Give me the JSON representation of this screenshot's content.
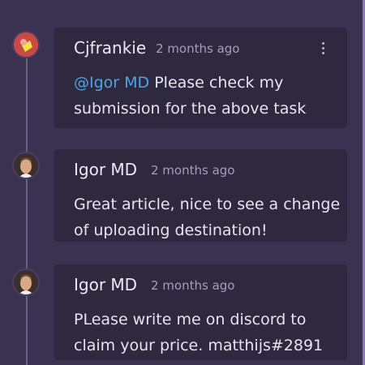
{
  "comments": [
    {
      "author": "Cjfrankie",
      "time": "2 months ago",
      "mention": "@Igor MD",
      "text": " Please check my submission for the above task",
      "avatar": "user-avatar-icon"
    },
    {
      "author": "Igor MD",
      "time": "2 months ago",
      "text": "Great article, nice to see a change of uploading destination!",
      "avatar": "user-avatar-icon"
    },
    {
      "author": "Igor MD",
      "time": "2 months ago",
      "text": "PLease write me on discord to claim your price. matthijs#2891",
      "avatar": "user-avatar-icon"
    }
  ],
  "icons": {
    "menu": "more-vertical-icon"
  },
  "colors": {
    "background": "#3b3150",
    "card": "#2f2940",
    "mention": "#4ea3e6",
    "text": "#e6e3ef",
    "muted": "#a59dbb"
  }
}
